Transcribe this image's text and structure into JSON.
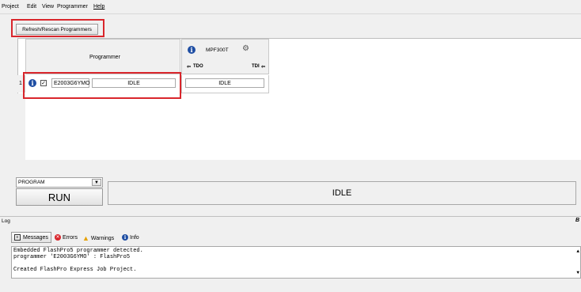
{
  "menu": [
    "Project",
    "Edit",
    "View",
    "Programmer",
    "Help"
  ],
  "toolbar": {
    "refresh_label": "Refresh/Rescan Programmers"
  },
  "grid": {
    "programmer_header": "Programmer",
    "device_header": "MPF300T",
    "tdo_label": "TDO",
    "tdi_label": "TDI",
    "rows": [
      {
        "index": "1",
        "programmer_id": "E2003G6YMO",
        "programmer_status": "IDLE",
        "device_status": "IDLE"
      }
    ]
  },
  "action": {
    "selected": "PROGRAM",
    "run_label": "RUN",
    "status": "IDLE"
  },
  "log": {
    "title": "Log",
    "tabs": [
      "Messages",
      "Errors",
      "Warnings",
      "Info"
    ],
    "lines": [
      "Embedded FlashPro5 programmer detected.",
      "programmer 'E2003G6YMO' : FlashPro5",
      "",
      "Created FlashPro Express Job Project."
    ]
  },
  "colors": {
    "highlight": "#d9262c",
    "info_blue": "#1f4ea3"
  }
}
